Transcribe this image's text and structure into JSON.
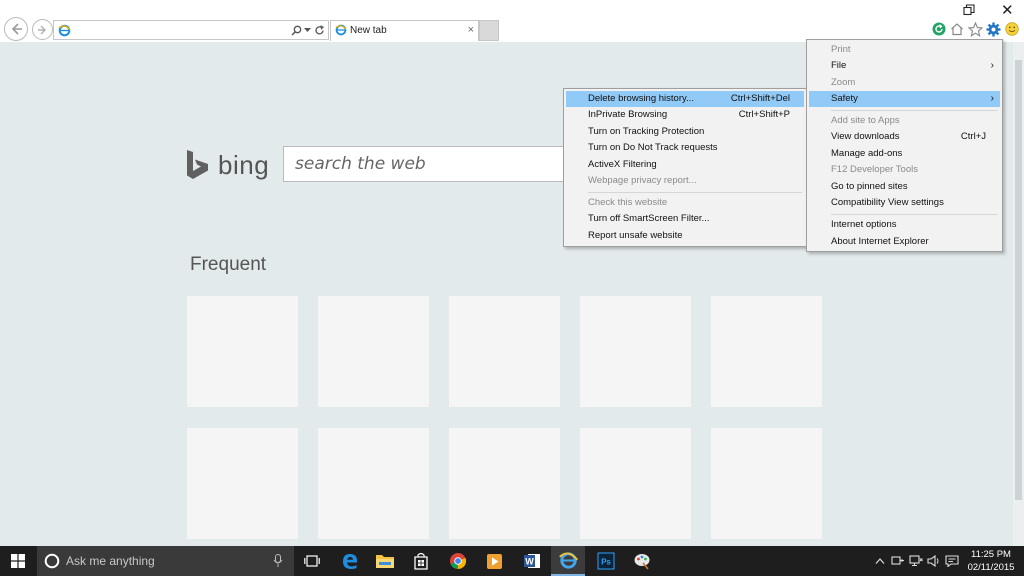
{
  "browser": {
    "address_value": "",
    "tab_label": "New tab",
    "tab_close": "×",
    "win_close": "✕"
  },
  "bing": {
    "logo_text": "bing",
    "search_placeholder": "search the web"
  },
  "frequent": {
    "title": "Frequent",
    "tile_count": 10
  },
  "safety_submenu": {
    "items": [
      {
        "label": "Delete browsing history...",
        "shortcut": "Ctrl+Shift+Del",
        "disabled": false,
        "highlighted": true
      },
      {
        "label": "InPrivate Browsing",
        "shortcut": "Ctrl+Shift+P",
        "disabled": false
      },
      {
        "label": "Turn on Tracking Protection",
        "shortcut": "",
        "disabled": false
      },
      {
        "label": "Turn on Do Not Track requests",
        "shortcut": "",
        "disabled": false
      },
      {
        "label": "ActiveX Filtering",
        "shortcut": "",
        "disabled": false
      },
      {
        "label": "Webpage privacy report...",
        "shortcut": "",
        "disabled": true
      },
      {
        "label": "Check this website",
        "shortcut": "",
        "disabled": true
      },
      {
        "label": "Turn off SmartScreen Filter...",
        "shortcut": "",
        "disabled": false
      },
      {
        "label": "Report unsafe website",
        "shortcut": "",
        "disabled": false
      }
    ]
  },
  "tools_menu": {
    "items": [
      {
        "label": "Print",
        "shortcut": "",
        "disabled": true,
        "submenu": false
      },
      {
        "label": "File",
        "shortcut": "",
        "disabled": false,
        "submenu": true
      },
      {
        "label": "Zoom",
        "shortcut": "",
        "disabled": true,
        "submenu": false
      },
      {
        "label": "Safety",
        "shortcut": "",
        "disabled": false,
        "submenu": true,
        "highlighted": true
      },
      {
        "label": "Add site to Apps",
        "shortcut": "",
        "disabled": true,
        "submenu": false
      },
      {
        "label": "View downloads",
        "shortcut": "Ctrl+J",
        "disabled": false,
        "submenu": false
      },
      {
        "label": "Manage add-ons",
        "shortcut": "",
        "disabled": false,
        "submenu": false
      },
      {
        "label": "F12 Developer Tools",
        "shortcut": "",
        "disabled": true,
        "submenu": false
      },
      {
        "label": "Go to pinned sites",
        "shortcut": "",
        "disabled": false,
        "submenu": false
      },
      {
        "label": "Compatibility View settings",
        "shortcut": "",
        "disabled": false,
        "submenu": false
      },
      {
        "label": "Internet options",
        "shortcut": "",
        "disabled": false,
        "submenu": false
      },
      {
        "label": "About Internet Explorer",
        "shortcut": "",
        "disabled": false,
        "submenu": false
      }
    ]
  },
  "taskbar": {
    "search_placeholder": "Ask me anything",
    "apps": [
      "task-view",
      "edge",
      "file-explorer",
      "store",
      "chrome",
      "media-player",
      "word",
      "internet-explorer",
      "photoshop",
      "paint"
    ],
    "clock_time": "11:25 PM",
    "clock_date": "02/11/2015"
  },
  "colors": {
    "page_bg": "#e3eaeb",
    "menu_highlight": "#91c9f7",
    "taskbar_bg": "#1e1e1e"
  }
}
